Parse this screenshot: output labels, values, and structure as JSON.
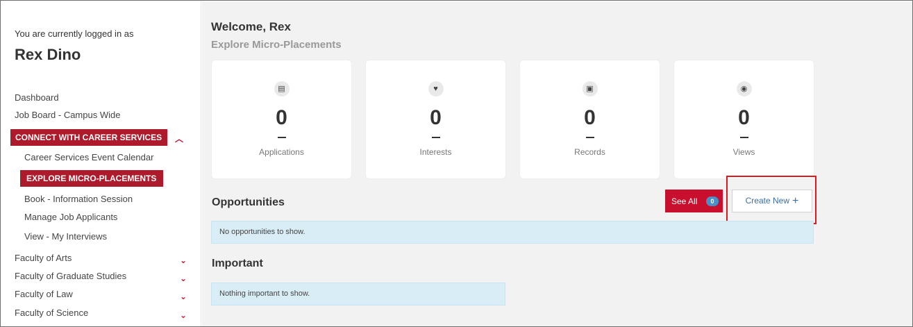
{
  "sidebar": {
    "logged_in_label": "You are currently logged in as",
    "user_name": "Rex Dino",
    "items": [
      {
        "label": "Dashboard"
      },
      {
        "label": "Job Board - Campus Wide"
      },
      {
        "label": "CONNECT WITH CAREER SERVICES",
        "expanded": true
      },
      {
        "label": "Career Services Event Calendar"
      },
      {
        "label": "EXPLORE MICRO-PLACEMENTS",
        "active": true
      },
      {
        "label": "Book - Information Session"
      },
      {
        "label": "Manage Job Applicants"
      },
      {
        "label": "View - My Interviews"
      },
      {
        "label": "Faculty of Arts"
      },
      {
        "label": "Faculty of Graduate Studies"
      },
      {
        "label": "Faculty of Law"
      },
      {
        "label": "Faculty of Science"
      }
    ]
  },
  "main": {
    "welcome": "Welcome, Rex",
    "subtitle": "Explore Micro-Placements",
    "stats": [
      {
        "icon": "file-icon",
        "glyph": "▤",
        "value": "0",
        "label": "Applications"
      },
      {
        "icon": "heart-icon",
        "glyph": "♥",
        "value": "0",
        "label": "Interests"
      },
      {
        "icon": "clipboard-icon",
        "glyph": "▣",
        "value": "0",
        "label": "Records"
      },
      {
        "icon": "eye-icon",
        "glyph": "◉",
        "value": "0",
        "label": "Views"
      }
    ],
    "opportunities": {
      "title": "Opportunities",
      "see_all_label": "See All",
      "see_all_count": "0",
      "create_new_label": "Create New",
      "empty_message": "No opportunities to show."
    },
    "important": {
      "title": "Important",
      "empty_message": "Nothing important to show."
    }
  },
  "colors": {
    "brand_red": "#ad1a2c",
    "button_red": "#c8102e",
    "info_bg": "#d9edf7",
    "highlight": "#e0171b",
    "badge_blue": "#4a90c8"
  }
}
